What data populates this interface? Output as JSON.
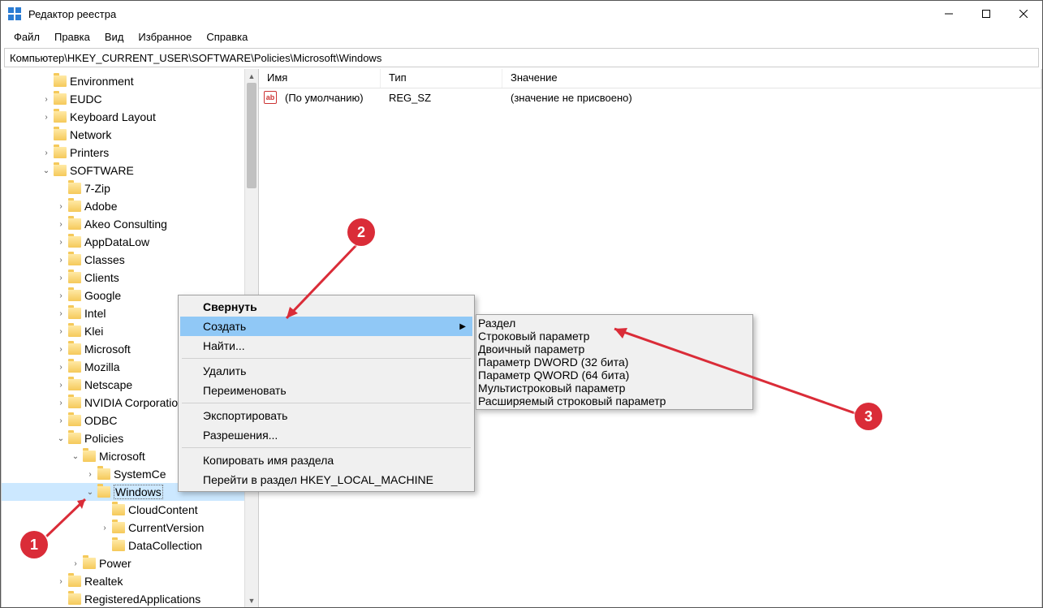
{
  "window": {
    "title": "Редактор реестра"
  },
  "menu": {
    "file": "Файл",
    "edit": "Правка",
    "view": "Вид",
    "favorites": "Избранное",
    "help": "Справка"
  },
  "address": "Компьютер\\HKEY_CURRENT_USER\\SOFTWARE\\Policies\\Microsoft\\Windows",
  "tree": [
    {
      "label": "Environment",
      "indent": 3,
      "twisty": ""
    },
    {
      "label": "EUDC",
      "indent": 3,
      "twisty": ">"
    },
    {
      "label": "Keyboard Layout",
      "indent": 3,
      "twisty": ">"
    },
    {
      "label": "Network",
      "indent": 3,
      "twisty": ""
    },
    {
      "label": "Printers",
      "indent": 3,
      "twisty": ">"
    },
    {
      "label": "SOFTWARE",
      "indent": 3,
      "twisty": "v"
    },
    {
      "label": "7-Zip",
      "indent": 4,
      "twisty": ""
    },
    {
      "label": "Adobe",
      "indent": 4,
      "twisty": ">"
    },
    {
      "label": "Akeo Consulting",
      "indent": 4,
      "twisty": ">"
    },
    {
      "label": "AppDataLow",
      "indent": 4,
      "twisty": ">"
    },
    {
      "label": "Classes",
      "indent": 4,
      "twisty": ">"
    },
    {
      "label": "Clients",
      "indent": 4,
      "twisty": ">"
    },
    {
      "label": "Google",
      "indent": 4,
      "twisty": ">"
    },
    {
      "label": "Intel",
      "indent": 4,
      "twisty": ">"
    },
    {
      "label": "Klei",
      "indent": 4,
      "twisty": ">"
    },
    {
      "label": "Microsoft",
      "indent": 4,
      "twisty": ">"
    },
    {
      "label": "Mozilla",
      "indent": 4,
      "twisty": ">"
    },
    {
      "label": "Netscape",
      "indent": 4,
      "twisty": ">"
    },
    {
      "label": "NVIDIA Corporation",
      "indent": 4,
      "twisty": ">"
    },
    {
      "label": "ODBC",
      "indent": 4,
      "twisty": ">"
    },
    {
      "label": "Policies",
      "indent": 4,
      "twisty": "v"
    },
    {
      "label": "Microsoft",
      "indent": 5,
      "twisty": "v"
    },
    {
      "label": "SystemCertificates",
      "indent": 6,
      "twisty": ">",
      "clip": "SystemCe"
    },
    {
      "label": "Windows",
      "indent": 6,
      "twisty": "v",
      "selected": true
    },
    {
      "label": "CloudContent",
      "indent": 7,
      "twisty": ""
    },
    {
      "label": "CurrentVersion",
      "indent": 7,
      "twisty": ">"
    },
    {
      "label": "DataCollection",
      "indent": 7,
      "twisty": ""
    },
    {
      "label": "Power",
      "indent": 5,
      "twisty": ">"
    },
    {
      "label": "Realtek",
      "indent": 4,
      "twisty": ">"
    },
    {
      "label": "RegisteredApplications",
      "indent": 4,
      "twisty": ""
    }
  ],
  "list": {
    "headers": {
      "name": "Имя",
      "type": "Тип",
      "value": "Значение"
    },
    "rows": [
      {
        "name": "(По умолчанию)",
        "type": "REG_SZ",
        "value": "(значение не присвоено)"
      }
    ]
  },
  "context_menu": {
    "items": [
      {
        "label": "Свернуть",
        "kind": "bold"
      },
      {
        "label": "Создать",
        "kind": "highlight",
        "submenu": true
      },
      {
        "label": "Найти...",
        "kind": ""
      },
      {
        "kind": "sep"
      },
      {
        "label": "Удалить",
        "kind": ""
      },
      {
        "label": "Переименовать",
        "kind": ""
      },
      {
        "kind": "sep"
      },
      {
        "label": "Экспортировать",
        "kind": ""
      },
      {
        "label": "Разрешения...",
        "kind": ""
      },
      {
        "kind": "sep"
      },
      {
        "label": "Копировать имя раздела",
        "kind": ""
      },
      {
        "label": "Перейти в раздел HKEY_LOCAL_MACHINE",
        "kind": ""
      }
    ]
  },
  "submenu": {
    "items": [
      {
        "label": "Раздел",
        "highlight": true
      },
      {
        "kind": "sep"
      },
      {
        "label": "Строковый параметр"
      },
      {
        "label": "Двоичный параметр"
      },
      {
        "label": "Параметр DWORD (32 бита)"
      },
      {
        "label": "Параметр QWORD (64 бита)"
      },
      {
        "label": "Мультистроковый параметр"
      },
      {
        "label": "Расширяемый строковый параметр"
      }
    ]
  },
  "annotations": {
    "b1": "1",
    "b2": "2",
    "b3": "3"
  },
  "icons": {
    "ab": "ab"
  }
}
